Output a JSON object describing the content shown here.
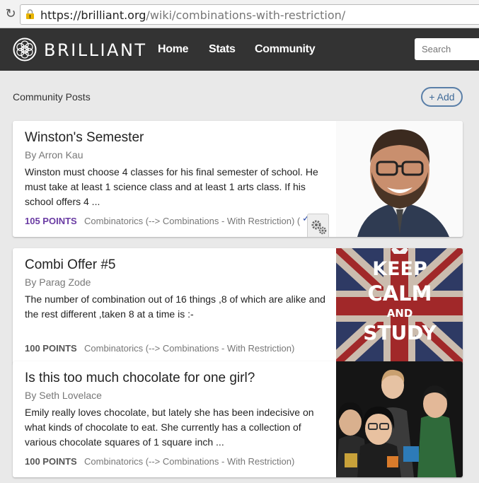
{
  "browser": {
    "url_host": "https://brilliant.org",
    "url_path": "/wiki/combinations-with-restriction/"
  },
  "nav": {
    "logo_text": "BRILLIANT",
    "links": [
      "Home",
      "Stats",
      "Community"
    ],
    "search_placeholder": "Search"
  },
  "section": {
    "title": "Community Posts",
    "add_label": "+ Add"
  },
  "posts": [
    {
      "title": "Winston's Semester",
      "author": "By Arron Kau",
      "body": "Winston must choose 4 classes for his final semester of school. He must take at least 1 science class and at least 1 arts class. If his school offers 4 ...",
      "points": "105 POINTS",
      "topics": "Combinatorics (--> Combinations - With Restriction) (",
      "image": "bearded-man-glasses-photo"
    },
    {
      "title": "Combi Offer #5",
      "author": "By Parag Zode",
      "body": "The number of combination out of 16 things ,8 of which are alike and the rest different ,taken 8 at a time is :-",
      "points": "100 POINTS",
      "topics": "Combinatorics (--> Combinations - With Restriction)",
      "image": "keep-calm-and-study-poster",
      "poster_lines": [
        "KEEP",
        "CALM",
        "AND",
        "STUDY"
      ]
    },
    {
      "title": "Is this too much chocolate for one girl?",
      "author": "By Seth Lovelace",
      "body": "Emily really loves chocolate, but lately she has been indecisive on what kinds of chocolate to eat. She currently has a collection of various chocolate squares of 1 square inch ...",
      "points": "100 POINTS",
      "topics": "Combinatorics (--> Combinations - With Restriction)",
      "image": "group-of-students-photo"
    }
  ],
  "colors": {
    "nav_bg": "#333333",
    "points_highlight": "#6a3ba3",
    "add_button": "#3f6a98",
    "page_bg": "#e9e9e9"
  }
}
